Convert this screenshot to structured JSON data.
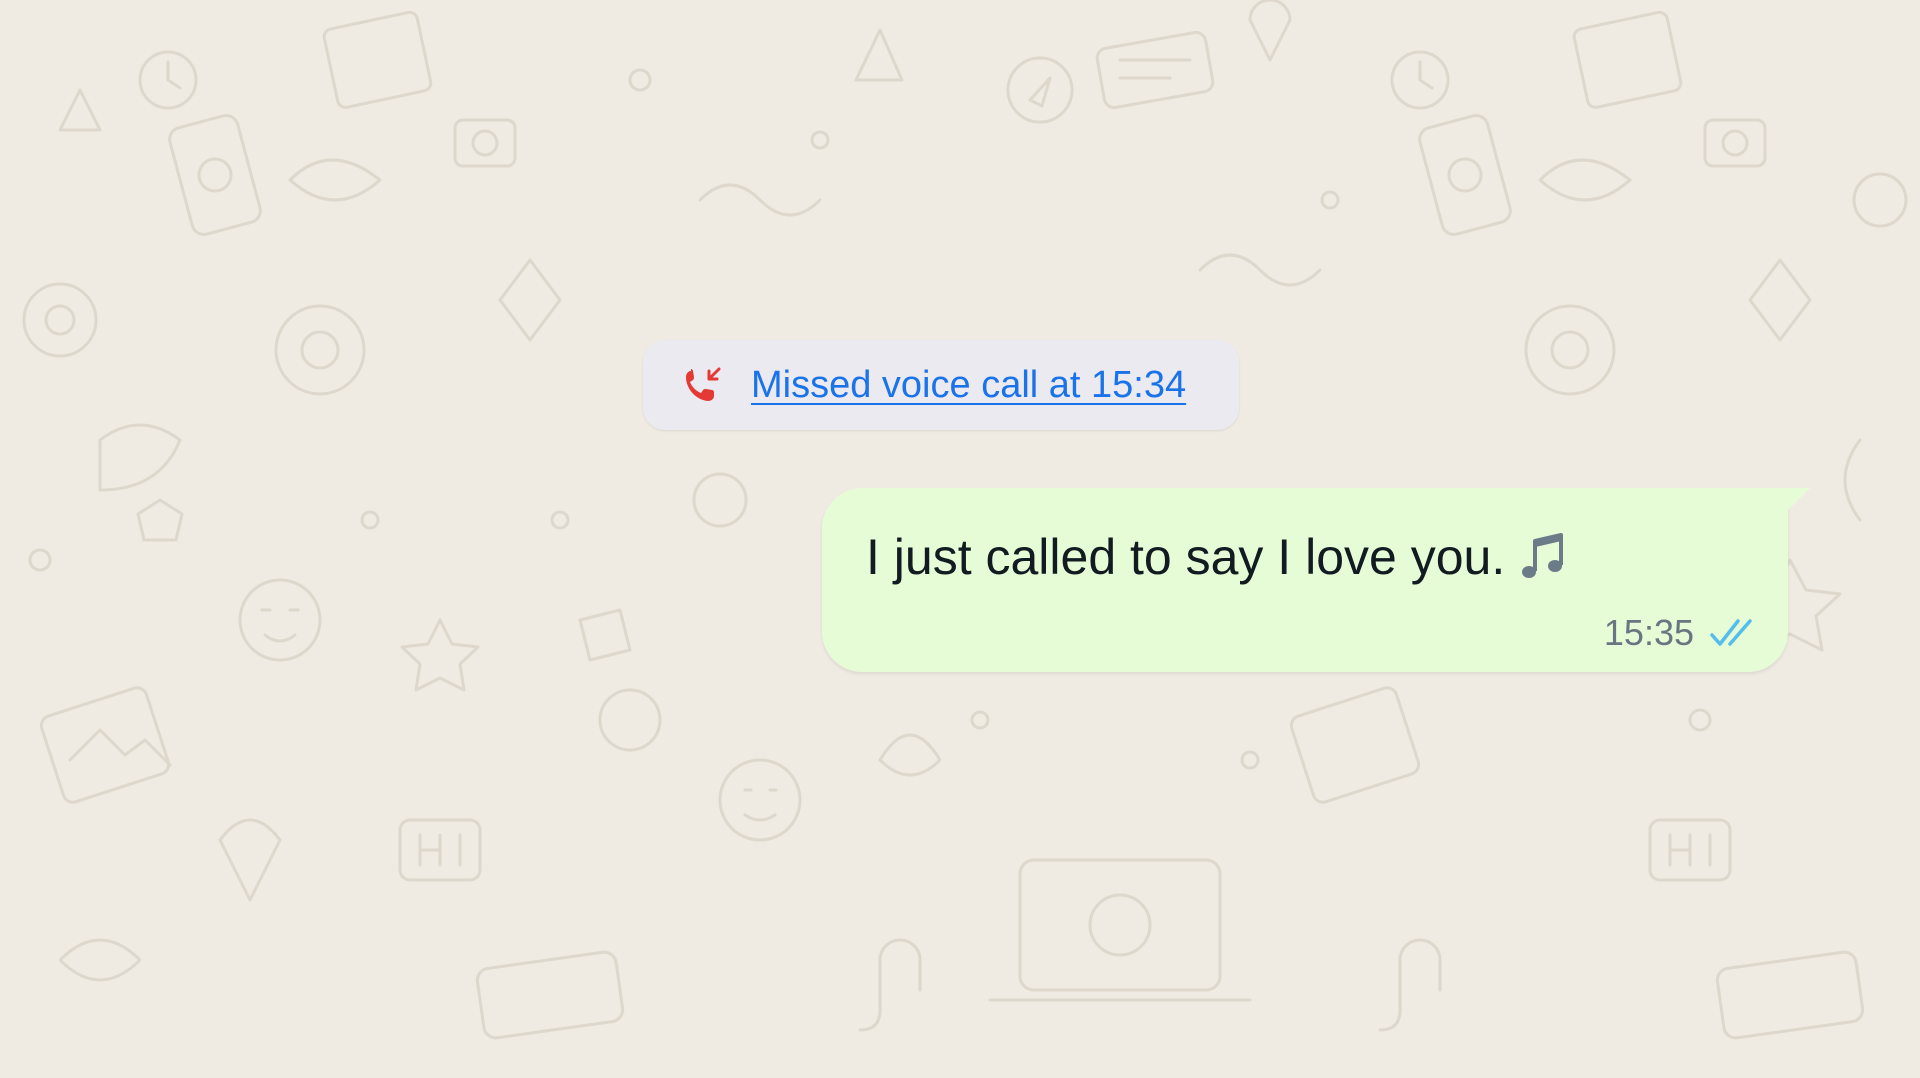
{
  "chat": {
    "system_message": {
      "icon": "missed-call-icon",
      "text": "Missed voice call at 15:34",
      "color": "#1a73e8",
      "icon_color": "#e53935"
    },
    "messages": [
      {
        "direction": "outgoing",
        "text": "I just called to say I love you.",
        "emoji_icon": "music-note-icon",
        "time": "15:35",
        "status": "read",
        "status_icon": "double-check-icon",
        "bubble_color": "#e5fcd6",
        "status_color": "#53bdeb"
      }
    ]
  },
  "colors": {
    "background": "#efeae2",
    "text": "#111b21",
    "meta_text": "#667781"
  }
}
